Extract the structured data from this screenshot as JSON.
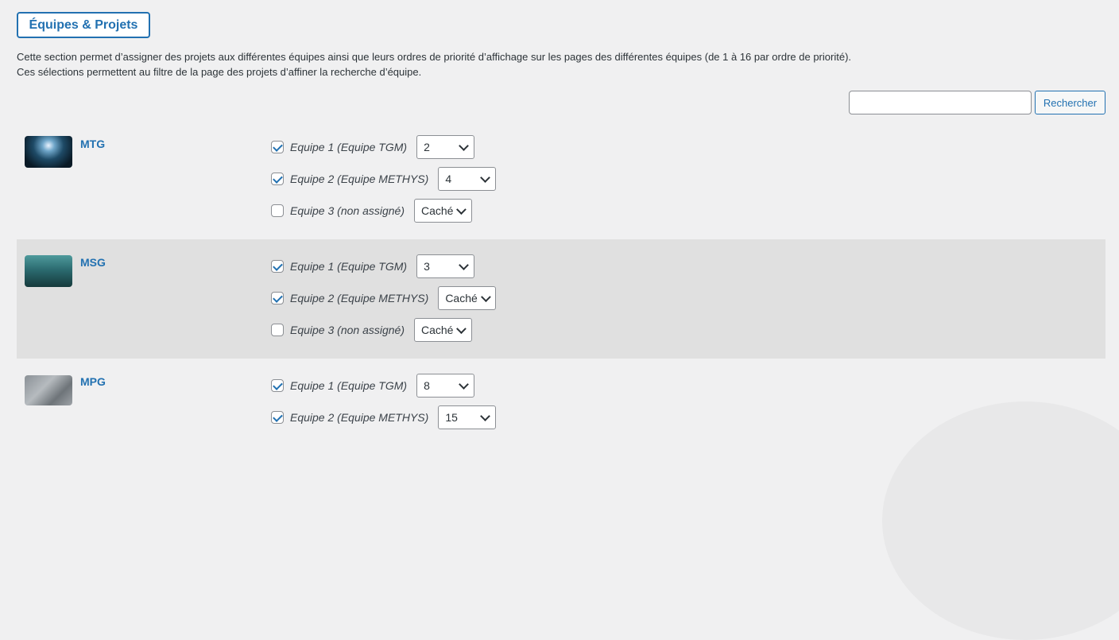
{
  "header": {
    "title": "Équipes & Projets",
    "desc_line1": "Cette section permet d’assigner des projets aux différentes équipes ainsi que leurs ordres de priorité d’affichage sur les pages des différentes équipes (de 1 à 16 par ordre de priorité).",
    "desc_line2": "Ces sélections permettent au filtre de la page des projets d’affiner la recherche d’équipe."
  },
  "search": {
    "placeholder": "",
    "button_label": "Rechercher"
  },
  "colors": {
    "accent": "#2271b1",
    "page_bg": "#f0f0f1",
    "alt_row_bg": "#e0e0e0"
  },
  "projects": [
    {
      "name": "MTG",
      "thumbnail": "underwater-cave-light-image",
      "teams": [
        {
          "label": "Equipe 1 (Equipe TGM)",
          "checked": true,
          "priority": "2"
        },
        {
          "label": "Equipe 2 (Equipe METHYS)",
          "checked": true,
          "priority": "4"
        },
        {
          "label": "Equipe 3 (non assigné)",
          "checked": false,
          "priority": "Caché"
        }
      ]
    },
    {
      "name": "MSG",
      "thumbnail": "underwater-teal-image",
      "teams": [
        {
          "label": "Equipe 1 (Equipe TGM)",
          "checked": true,
          "priority": "3"
        },
        {
          "label": "Equipe 2 (Equipe METHYS)",
          "checked": true,
          "priority": "Caché"
        },
        {
          "label": "Equipe 3 (non assigné)",
          "checked": false,
          "priority": "Caché"
        }
      ]
    },
    {
      "name": "MPG",
      "thumbnail": "rocky-grey-image",
      "teams": [
        {
          "label": "Equipe 1 (Equipe TGM)",
          "checked": true,
          "priority": "8"
        },
        {
          "label": "Equipe 2 (Equipe METHYS)",
          "checked": true,
          "priority": "15"
        }
      ]
    }
  ]
}
